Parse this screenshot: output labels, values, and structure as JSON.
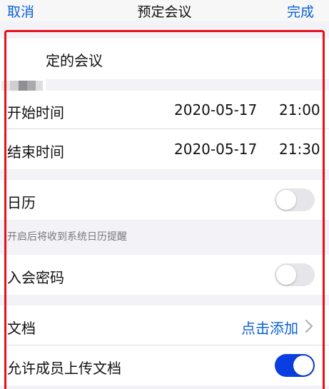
{
  "nav": {
    "cancel_label": "取消",
    "title": "预定会议",
    "done_label": "完成"
  },
  "topic": {
    "text": "定的会议"
  },
  "start": {
    "label": "开始时间",
    "date": "2020-05-17",
    "time": "21:00"
  },
  "end": {
    "label": "结束时间",
    "date": "2020-05-17",
    "time": "21:30"
  },
  "calendar": {
    "label": "日历",
    "enabled": false,
    "hint": "开启后将收到系统日历提醒"
  },
  "password": {
    "label": "入会密码",
    "enabled": false
  },
  "documents": {
    "label": "文档",
    "action": "点击添加"
  },
  "allow_upload": {
    "label": "允许成员上传文档",
    "enabled": true
  },
  "colors": {
    "accent": "#0a60d8",
    "toggle_on": "#0a3ee0",
    "annotation": "#e8101a"
  }
}
